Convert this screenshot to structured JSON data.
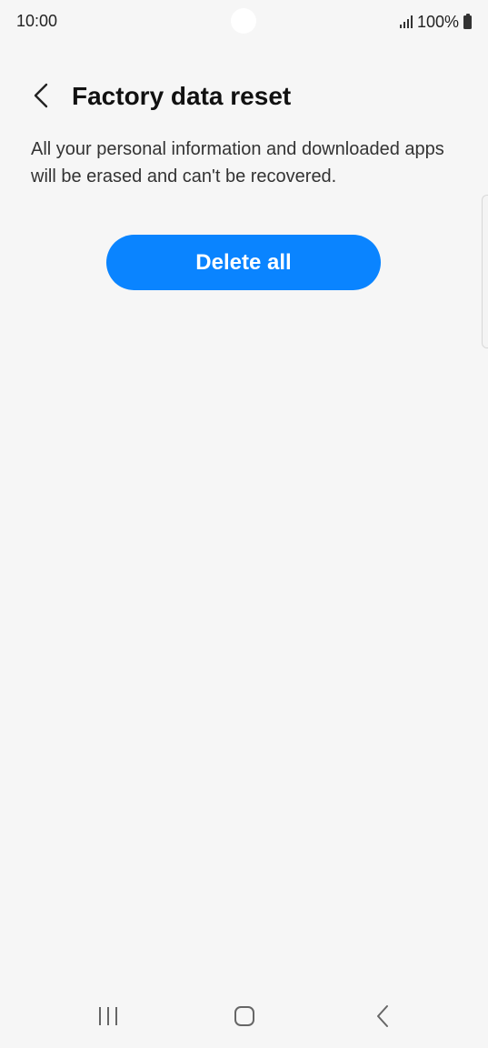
{
  "status_bar": {
    "time": "10:00",
    "battery": "100%",
    "icons": [
      "signal-icon",
      "battery-icon"
    ]
  },
  "header": {
    "back_icon": "chevron-left-icon",
    "title": "Factory data reset"
  },
  "main": {
    "description": "All your personal information and downloaded apps will be erased and can't be recovered.",
    "delete_button_label": "Delete all"
  },
  "nav_bar": {
    "icons": [
      "recents-icon",
      "home-icon",
      "back-icon"
    ]
  },
  "colors": {
    "background": "#f6f6f6",
    "accent": "#0a84ff",
    "button_text": "#ffffff",
    "title_text": "#111111"
  }
}
